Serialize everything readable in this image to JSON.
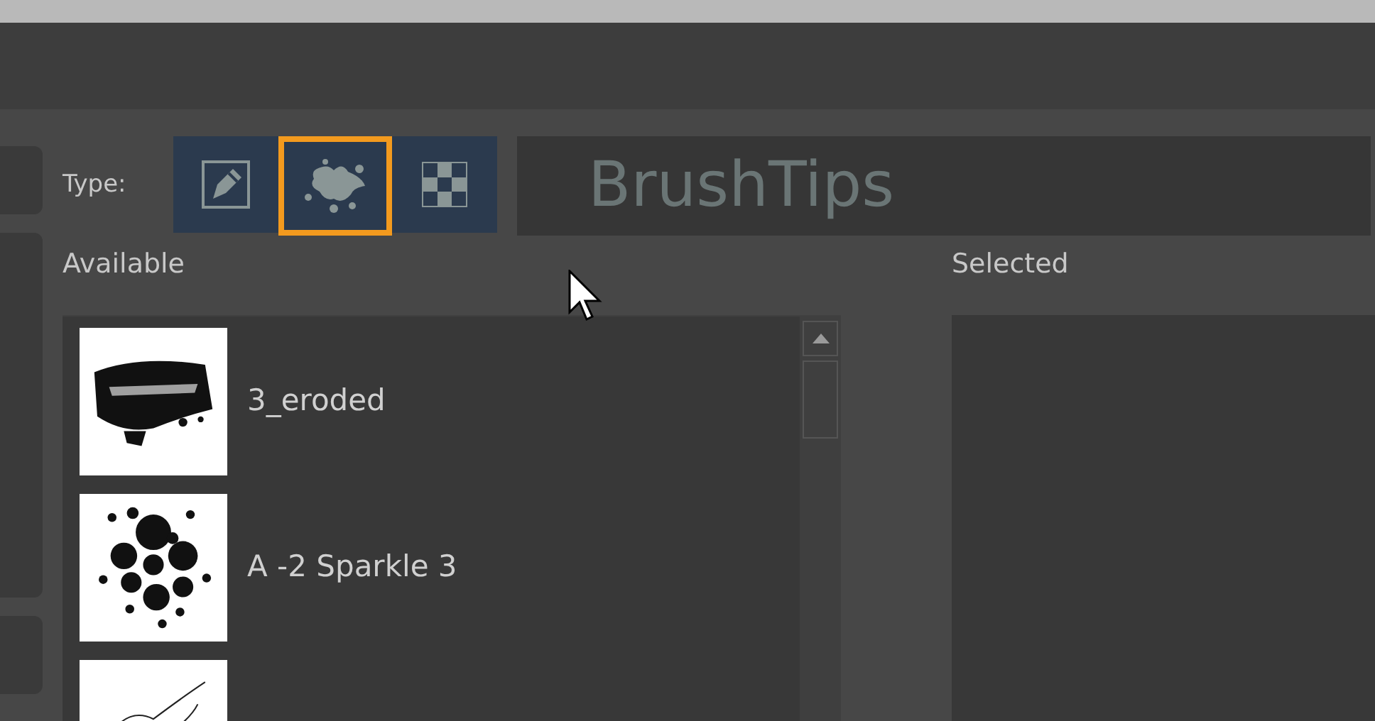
{
  "type_selector": {
    "label": "Type:",
    "options": [
      {
        "kind": "brush",
        "selected": false
      },
      {
        "kind": "splat",
        "selected": true
      },
      {
        "kind": "checker",
        "selected": false
      }
    ]
  },
  "overlay_title": "BrushTips",
  "available": {
    "label": "Available",
    "items": [
      {
        "kind": "eroded",
        "name": "3_eroded"
      },
      {
        "kind": "dots",
        "name": "A -2 Sparkle 3"
      },
      {
        "kind": "sketch"
      }
    ]
  },
  "selected": {
    "label": "Selected"
  }
}
